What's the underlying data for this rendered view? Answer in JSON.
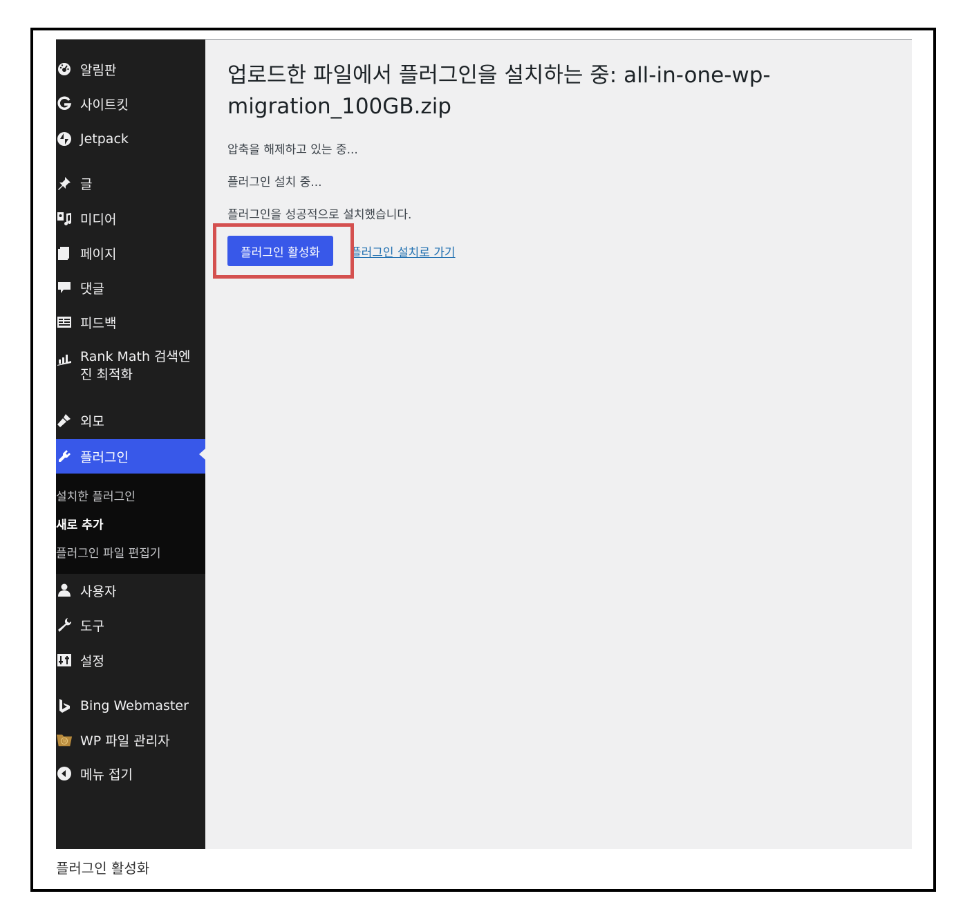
{
  "sidebar": {
    "items": [
      {
        "label": "알림판",
        "icon": "dashboard-icon"
      },
      {
        "label": "사이트킷",
        "icon": "sitekit-g-icon"
      },
      {
        "label": "Jetpack",
        "icon": "jetpack-icon"
      },
      {
        "label": "글",
        "icon": "pin-icon"
      },
      {
        "label": "미디어",
        "icon": "media-icon"
      },
      {
        "label": "페이지",
        "icon": "page-icon"
      },
      {
        "label": "댓글",
        "icon": "comment-icon"
      },
      {
        "label": "피드백",
        "icon": "feedback-icon"
      },
      {
        "label": "Rank Math 검색엔진 최적화",
        "icon": "rank-math-icon"
      },
      {
        "label": "외모",
        "icon": "appearance-icon"
      },
      {
        "label": "플러그인",
        "icon": "plugin-icon",
        "active": true
      },
      {
        "label": "사용자",
        "icon": "users-icon"
      },
      {
        "label": "도구",
        "icon": "tools-icon"
      },
      {
        "label": "설정",
        "icon": "settings-icon"
      },
      {
        "label": "Bing Webmaster",
        "icon": "bing-icon"
      },
      {
        "label": "WP 파일 관리자",
        "icon": "file-manager-icon"
      },
      {
        "label": "메뉴 접기",
        "icon": "collapse-icon"
      }
    ],
    "submenu": [
      {
        "label": "설치한 플러그인"
      },
      {
        "label": "새로 추가",
        "current": true
      },
      {
        "label": "플러그인 파일 편집기"
      }
    ]
  },
  "main": {
    "title": "업로드한 파일에서 플러그인을 설치하는 중: all-in-one-wp-migration_100GB.zip",
    "status_lines": [
      "압축을 해제하고 있는 중...",
      "플러그인 설치 중...",
      "플러그인을 성공적으로 설치했습니다."
    ],
    "activate_button": "플러그인 활성화",
    "back_link": "플러그인 설치로 가기"
  },
  "caption": "플러그인 활성화",
  "colors": {
    "sidebar_bg": "#1e1e1e",
    "accent": "#3858e9",
    "highlight": "#d4504f",
    "content_bg": "#f0f0f1"
  }
}
